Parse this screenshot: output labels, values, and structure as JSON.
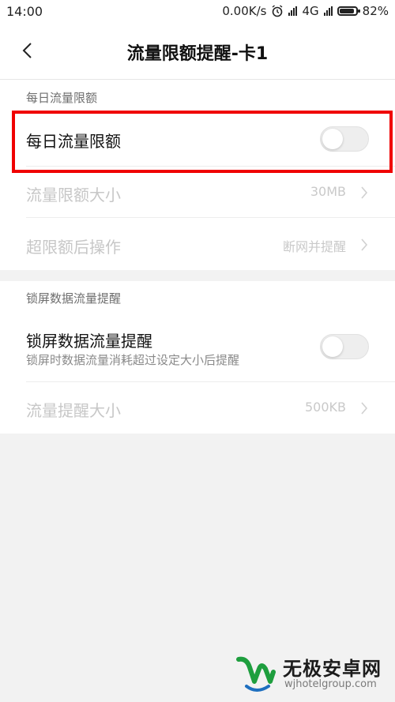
{
  "status_bar": {
    "time": "14:00",
    "speed": "0.00K/s",
    "network": "4G",
    "battery": "82%",
    "icons": [
      "alarm-icon",
      "signal-icon",
      "signal-icon",
      "battery-icon"
    ]
  },
  "header": {
    "title": "流量限额提醒-卡1",
    "back_icon": "back-arrow-icon"
  },
  "sections": [
    {
      "header": "每日流量限额",
      "rows": [
        {
          "title": "每日流量限额",
          "control": "toggle",
          "on": false
        },
        {
          "title": "流量限额大小",
          "value": "30MB",
          "disabled": true
        },
        {
          "title": "超限额后操作",
          "value": "断网并提醒",
          "disabled": true
        }
      ]
    },
    {
      "header": "锁屏数据流量提醒",
      "rows": [
        {
          "title": "锁屏数据流量提醒",
          "subtitle": "锁屏时数据流量消耗超过设定大小后提醒",
          "control": "toggle",
          "on": false
        },
        {
          "title": "流量提醒大小",
          "value": "500KB",
          "disabled": true
        }
      ]
    }
  ],
  "highlight_color": "#f00000",
  "watermark": {
    "title": "无极安卓网",
    "url": "wjhotelgroup.com"
  }
}
